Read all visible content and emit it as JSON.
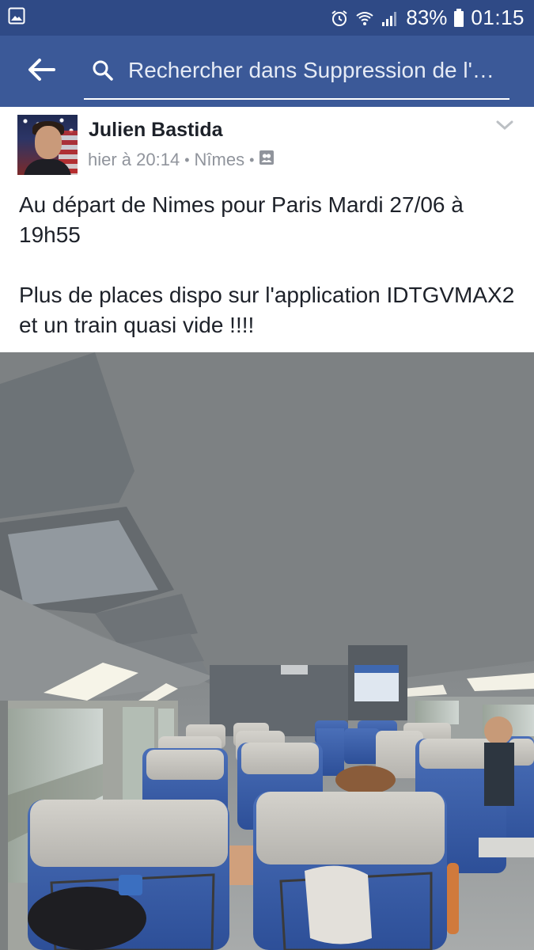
{
  "status_bar": {
    "battery_percent": "83%",
    "time": "01:15",
    "icons": [
      "gallery-icon",
      "alarm-icon",
      "wifi-icon",
      "signal-icon",
      "battery-icon"
    ]
  },
  "toolbar": {
    "search_placeholder": "Rechercher dans Suppression de l'…",
    "icons": [
      "back-arrow-icon",
      "search-icon"
    ]
  },
  "post": {
    "author": "Julien Bastida",
    "time": "hier à 20:14",
    "location": "Nîmes",
    "separator": "•",
    "paragraph_1": "Au départ de Nimes pour Paris Mardi 27/06 à 19h55",
    "paragraph_2": "Plus de places dispo sur l'application IDTGVMAX2 et un train quasi vide !!!!",
    "icons": [
      "audience-friends-icon",
      "chevron-down-icon"
    ]
  },
  "photo": {
    "subject": "train-interior-photo"
  },
  "colors": {
    "status_bar_bg": "#2f4a86",
    "toolbar_bg": "#3b5998",
    "author_text": "#1d2129",
    "meta_text": "#90949c"
  }
}
